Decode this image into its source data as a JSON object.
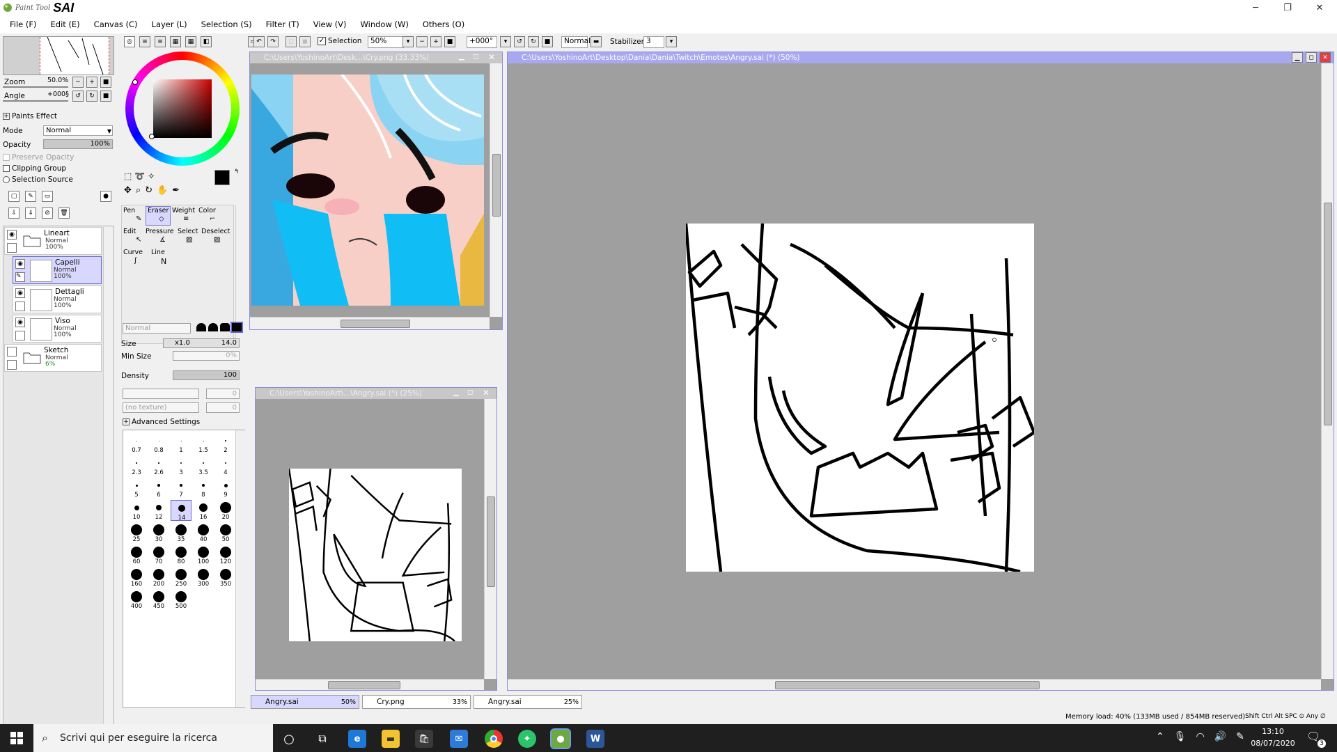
{
  "app": {
    "logo_small": "Paint Tool",
    "logo_big": "SAI"
  },
  "window_controls": {
    "minimize": "─",
    "restore": "❐",
    "close": "✕"
  },
  "menu": [
    "File (F)",
    "Edit (E)",
    "Canvas (C)",
    "Layer (L)",
    "Selection (S)",
    "Filter (T)",
    "View (V)",
    "Window (W)",
    "Others (O)"
  ],
  "navigator": {
    "zoom_label": "Zoom",
    "zoom_value": "50.0%",
    "angle_label": "Angle",
    "angle_value": "+000§"
  },
  "paints_effect": {
    "header": "Paints Effect",
    "mode_label": "Mode",
    "mode_value": "Normal",
    "opacity_label": "Opacity",
    "opacity_value": "100%",
    "preserve_opacity": "Preserve Opacity",
    "clipping_group": "Clipping Group",
    "selection_source": "Selection Source"
  },
  "layers": [
    {
      "name": "Lineart",
      "mode": "Normal",
      "opacity": "100%",
      "type": "folder"
    },
    {
      "name": "Capelli",
      "mode": "Normal",
      "opacity": "100%",
      "type": "layer",
      "selected": true
    },
    {
      "name": "Dettagli",
      "mode": "Normal",
      "opacity": "100%",
      "type": "layer"
    },
    {
      "name": "Viso",
      "mode": "Normal",
      "opacity": "100%",
      "type": "layer"
    },
    {
      "name": "Sketch",
      "mode": "Normal",
      "opacity": "6%",
      "type": "folder"
    }
  ],
  "toolbar": {
    "selection_label": "Selection",
    "zoom_value": "50%",
    "angle_value": "+000°",
    "blend_value": "Normal",
    "stabilizer_label": "Stabilizer",
    "stabilizer_value": "3"
  },
  "tools": {
    "pen": "Pen",
    "eraser": "Eraser",
    "weight": "Weight",
    "color": "Color",
    "edit": "Edit",
    "pressure": "Pressure",
    "select": "Select",
    "deselect": "Deselect",
    "curve": "Curve",
    "line": "Line"
  },
  "brush_settings": {
    "blend_mode": "Normal",
    "size_label": "Size",
    "size_multiplier": "x1.0",
    "size_value": "14.0",
    "min_size_label": "Min Size",
    "min_size_value": "0%",
    "density_label": "Density",
    "density_value": "100",
    "texture_value": "(no texture)",
    "texture_field_1": "0",
    "texture_field_2": "0",
    "advanced": "Advanced Settings"
  },
  "brush_sizes": [
    {
      "label": "0.7",
      "d": 1
    },
    {
      "label": "0.8",
      "d": 1
    },
    {
      "label": "1",
      "d": 1
    },
    {
      "label": "1.5",
      "d": 1
    },
    {
      "label": "2",
      "d": 1.5
    },
    {
      "label": "2.3",
      "d": 1.5
    },
    {
      "label": "2.6",
      "d": 1.5
    },
    {
      "label": "3",
      "d": 2
    },
    {
      "label": "3.5",
      "d": 2
    },
    {
      "label": "4",
      "d": 2.5
    },
    {
      "label": "5",
      "d": 3
    },
    {
      "label": "6",
      "d": 3.5
    },
    {
      "label": "7",
      "d": 4
    },
    {
      "label": "8",
      "d": 4.5
    },
    {
      "label": "9",
      "d": 5
    },
    {
      "label": "10",
      "d": 7
    },
    {
      "label": "12",
      "d": 8
    },
    {
      "label": "14",
      "d": 10
    },
    {
      "label": "16",
      "d": 12
    },
    {
      "label": "20",
      "d": 16
    },
    {
      "label": "25",
      "d": 16
    },
    {
      "label": "30",
      "d": 16
    },
    {
      "label": "35",
      "d": 16
    },
    {
      "label": "40",
      "d": 16
    },
    {
      "label": "50",
      "d": 16
    },
    {
      "label": "60",
      "d": 16
    },
    {
      "label": "70",
      "d": 16
    },
    {
      "label": "80",
      "d": 16
    },
    {
      "label": "100",
      "d": 16
    },
    {
      "label": "120",
      "d": 16
    },
    {
      "label": "160",
      "d": 16
    },
    {
      "label": "200",
      "d": 16
    },
    {
      "label": "250",
      "d": 16
    },
    {
      "label": "300",
      "d": 16
    },
    {
      "label": "350",
      "d": 16
    },
    {
      "label": "400",
      "d": 16
    },
    {
      "label": "450",
      "d": 16
    },
    {
      "label": "500",
      "d": 16
    }
  ],
  "documents": {
    "cry": {
      "title": "C:\\Users\\YoshinoArt\\Desk...\\Cry.png (33.33%)"
    },
    "angry_small": {
      "title": "C:\\Users\\YoshinoArt\\...\\Angry.sai (*) (25%)"
    },
    "angry_main": {
      "title": "C:\\Users\\YoshinoArt\\Desktop\\Dania\\Dania\\Twitch\\Emotes\\Angry.sai (*) (50%)"
    }
  },
  "tabs": [
    {
      "name": "Angry.sai",
      "zoom": "50%",
      "active": true
    },
    {
      "name": "Cry.png",
      "zoom": "33%",
      "active": false
    },
    {
      "name": "Angry.sai",
      "zoom": "25%",
      "active": false
    }
  ],
  "status": {
    "memory": "Memory load: 40% (133MB used / 854MB reserved)",
    "keys": "Shift Ctrl Alt SPC ⊙ Any ∅"
  },
  "taskbar": {
    "search_placeholder": "Scrivi qui per eseguire la ricerca",
    "time": "13:10",
    "date": "08/07/2020",
    "notifications": "3"
  },
  "colors": {
    "accent": "#a8a8f0",
    "canvas_bg": "#9f9f9f",
    "selected_layer": "#d8d8ff",
    "cry_hair": "#7fd0f0",
    "tear": "#11bdf5"
  }
}
